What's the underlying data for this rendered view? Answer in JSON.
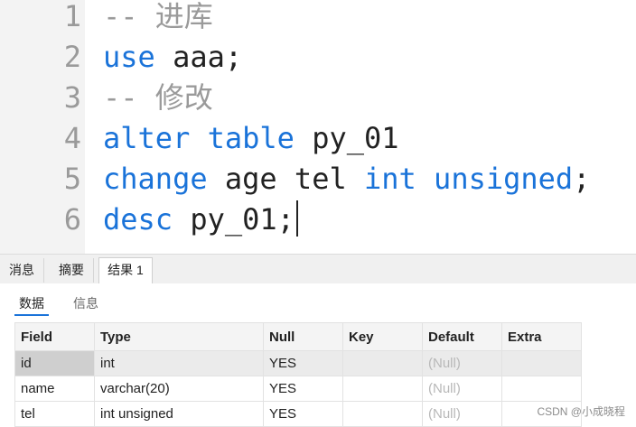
{
  "editor": {
    "lines": [
      {
        "num": "1",
        "tokens": [
          {
            "t": "-- 进库",
            "c": "cm"
          }
        ]
      },
      {
        "num": "2",
        "tokens": [
          {
            "t": "use",
            "c": "kw"
          },
          {
            "t": " aaa;",
            "c": ""
          }
        ]
      },
      {
        "num": "3",
        "tokens": [
          {
            "t": "-- 修改",
            "c": "cm"
          }
        ]
      },
      {
        "num": "4",
        "tokens": [
          {
            "t": "alter",
            "c": "kw"
          },
          {
            "t": " ",
            "c": ""
          },
          {
            "t": "table",
            "c": "kw"
          },
          {
            "t": " py_01",
            "c": ""
          }
        ]
      },
      {
        "num": "5",
        "tokens": [
          {
            "t": "change",
            "c": "kw"
          },
          {
            "t": " age tel ",
            "c": ""
          },
          {
            "t": "int",
            "c": "kw"
          },
          {
            "t": " ",
            "c": ""
          },
          {
            "t": "unsigned",
            "c": "kw"
          },
          {
            "t": ";",
            "c": ""
          }
        ]
      },
      {
        "num": "6",
        "tokens": [
          {
            "t": "desc",
            "c": "kw"
          },
          {
            "t": " py_01;",
            "c": ""
          }
        ]
      }
    ]
  },
  "result_tabs": [
    {
      "label": "消息",
      "active": false
    },
    {
      "label": "摘要",
      "active": false
    },
    {
      "label": "结果 1",
      "active": true
    }
  ],
  "sub_tabs": {
    "data": "数据",
    "info": "信息"
  },
  "grid": {
    "columns": [
      "Field",
      "Type",
      "Null",
      "Key",
      "Default",
      "Extra"
    ],
    "rows": [
      [
        "id",
        "int",
        "YES",
        "",
        "(Null)",
        ""
      ],
      [
        "name",
        "varchar(20)",
        "YES",
        "",
        "(Null)",
        ""
      ],
      [
        "tel",
        "int unsigned",
        "YES",
        "",
        "(Null)",
        ""
      ]
    ]
  },
  "watermark": "CSDN @小成晓程",
  "colors": {
    "keyword": "#1a73d9",
    "comment": "#9a9a9a",
    "accent": "#1a73d9"
  }
}
